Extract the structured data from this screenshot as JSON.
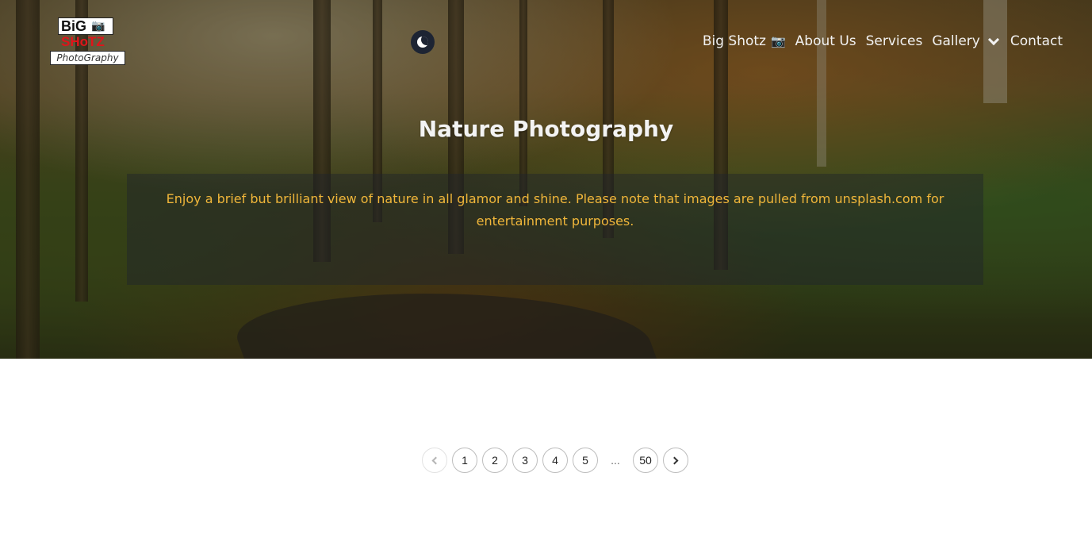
{
  "header": {
    "logo": {
      "line1": "BiG",
      "line2": "SHoTZ",
      "line3": "PhotoGraphy"
    },
    "theme_toggle": {
      "icon": "moon-icon"
    },
    "nav": [
      {
        "label": "Big Shotz",
        "icon": "camera-icon"
      },
      {
        "label": "About Us"
      },
      {
        "label": "Services"
      },
      {
        "label": "Gallery",
        "icon": "chevron-down-icon"
      },
      {
        "label": "Contact"
      }
    ]
  },
  "hero": {
    "title": "Nature Photography",
    "description": "Enjoy a brief but brilliant view of nature in all glamor and shine. Please note that images are pulled from unsplash.com for entertainment purposes."
  },
  "pagination": {
    "pages": [
      "1",
      "2",
      "3",
      "4",
      "5"
    ],
    "ellipsis": "...",
    "last": "50",
    "prev_icon": "chevron-left-icon",
    "next_icon": "chevron-right-icon"
  },
  "colors": {
    "accent_text": "#f0b63a",
    "toggle_bg": "#1d2433"
  }
}
